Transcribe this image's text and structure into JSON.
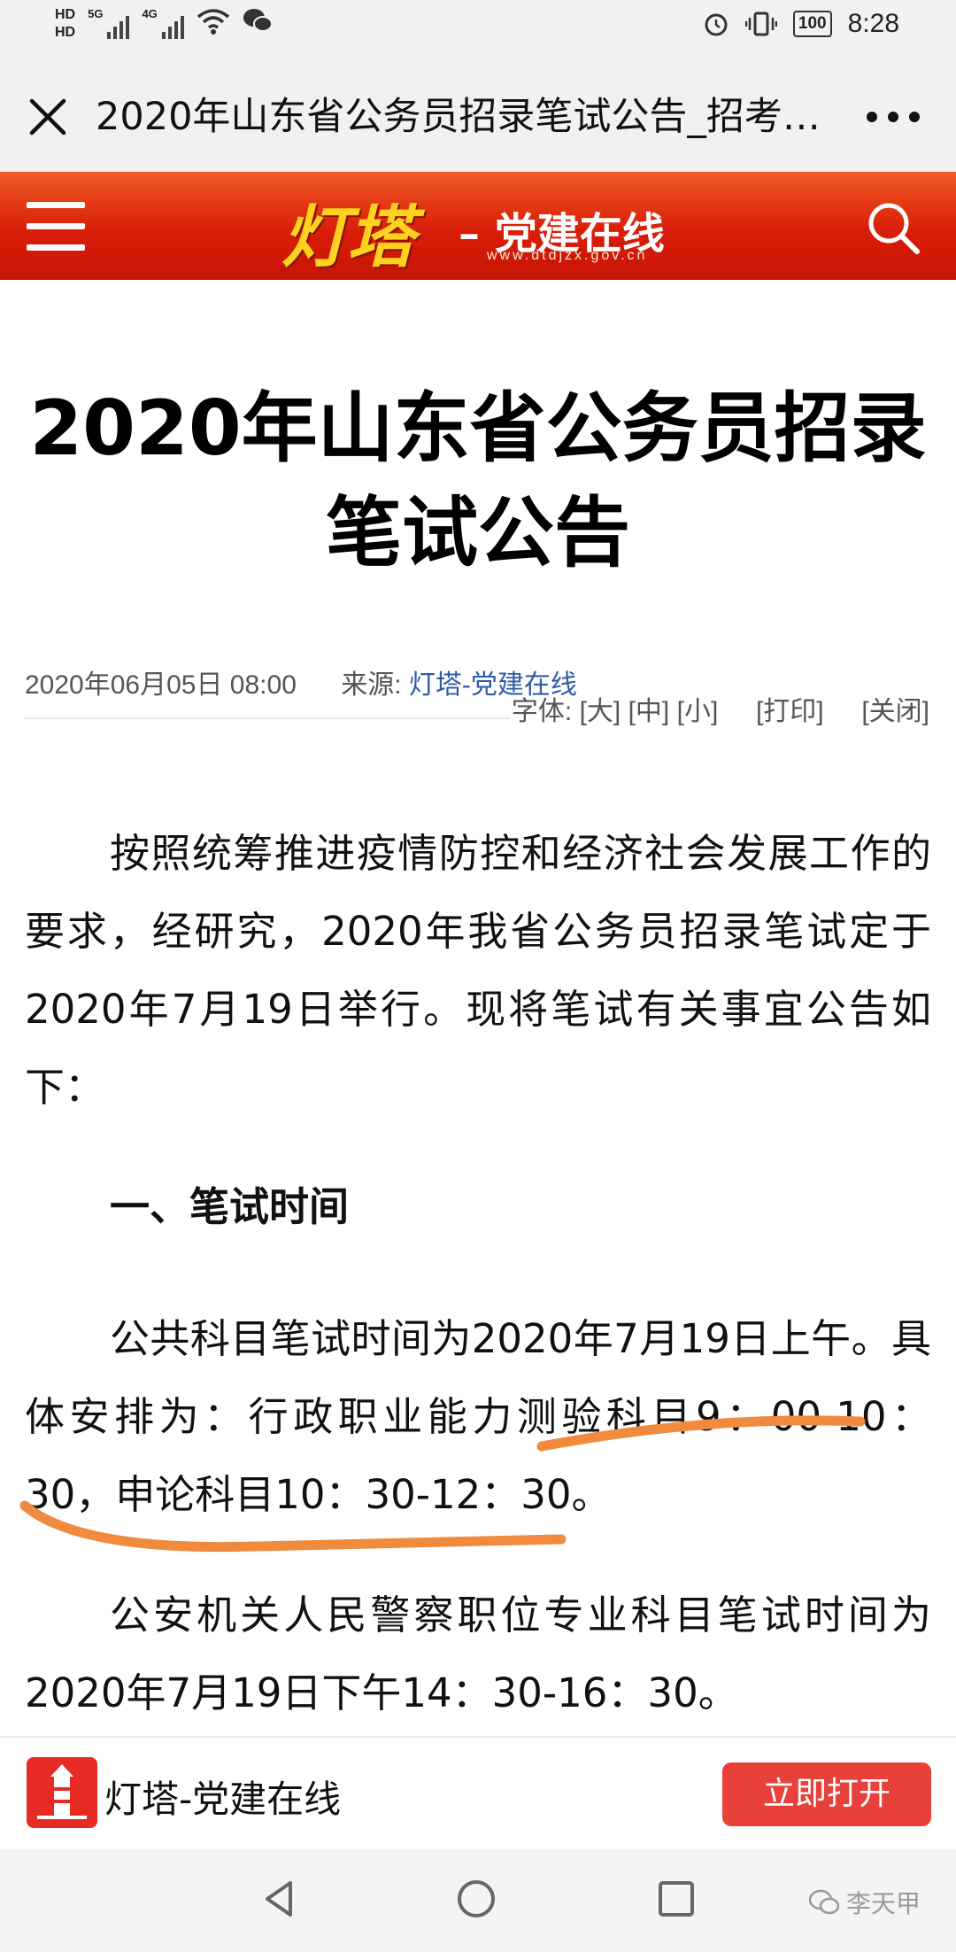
{
  "status_bar": {
    "hd1": "HD",
    "hd2": "HD",
    "signal1": "5G",
    "signal2": "4G",
    "battery": "100",
    "time": "8:28"
  },
  "browser": {
    "title": "2020年山东省公务员招录笔试公告_招考…",
    "close_icon": "close-icon",
    "more_icon": "more-horizontal-icon"
  },
  "site": {
    "logo_main": "灯塔",
    "logo_sub": "– 党建在线",
    "logo_url": "www.dtdjzx.gov.cn"
  },
  "article": {
    "title": "2020年山东省公务员招录笔试公告",
    "date": "2020年06月05日 08:00",
    "source_label": "来源:",
    "source": "灯塔-党建在线",
    "font_label": "字体:",
    "font_large": "[大]",
    "font_medium": "[中]",
    "font_small": "[小]",
    "print": "[打印]",
    "close": "[关闭]",
    "paragraph1": "按照统筹推进疫情防控和经济社会发展工作的要求，经研究，2020年我省公务员招录笔试定于2020年7月19日举行。现将笔试有关事宜公告如下：",
    "section1_heading": "一、笔试时间",
    "paragraph2": "公共科目笔试时间为2020年7月19日上午。具体安排为：行政职业能力测验科目9：00-10：30，申论科目10：30-12：30。",
    "paragraph3": "公安机关人民警察职位专业科目笔试时间为2020年7月19日下午14：30-16：30。"
  },
  "app_banner": {
    "name": "灯塔-党建在线",
    "open_button": "立即打开"
  },
  "watermark": "李天甲",
  "colors": {
    "header_red": "#d81e08",
    "logo_yellow": "#ffd21f",
    "link_blue": "#2f5ca8",
    "open_button": "#e8403a",
    "highlight_orange": "#f08a3c"
  }
}
